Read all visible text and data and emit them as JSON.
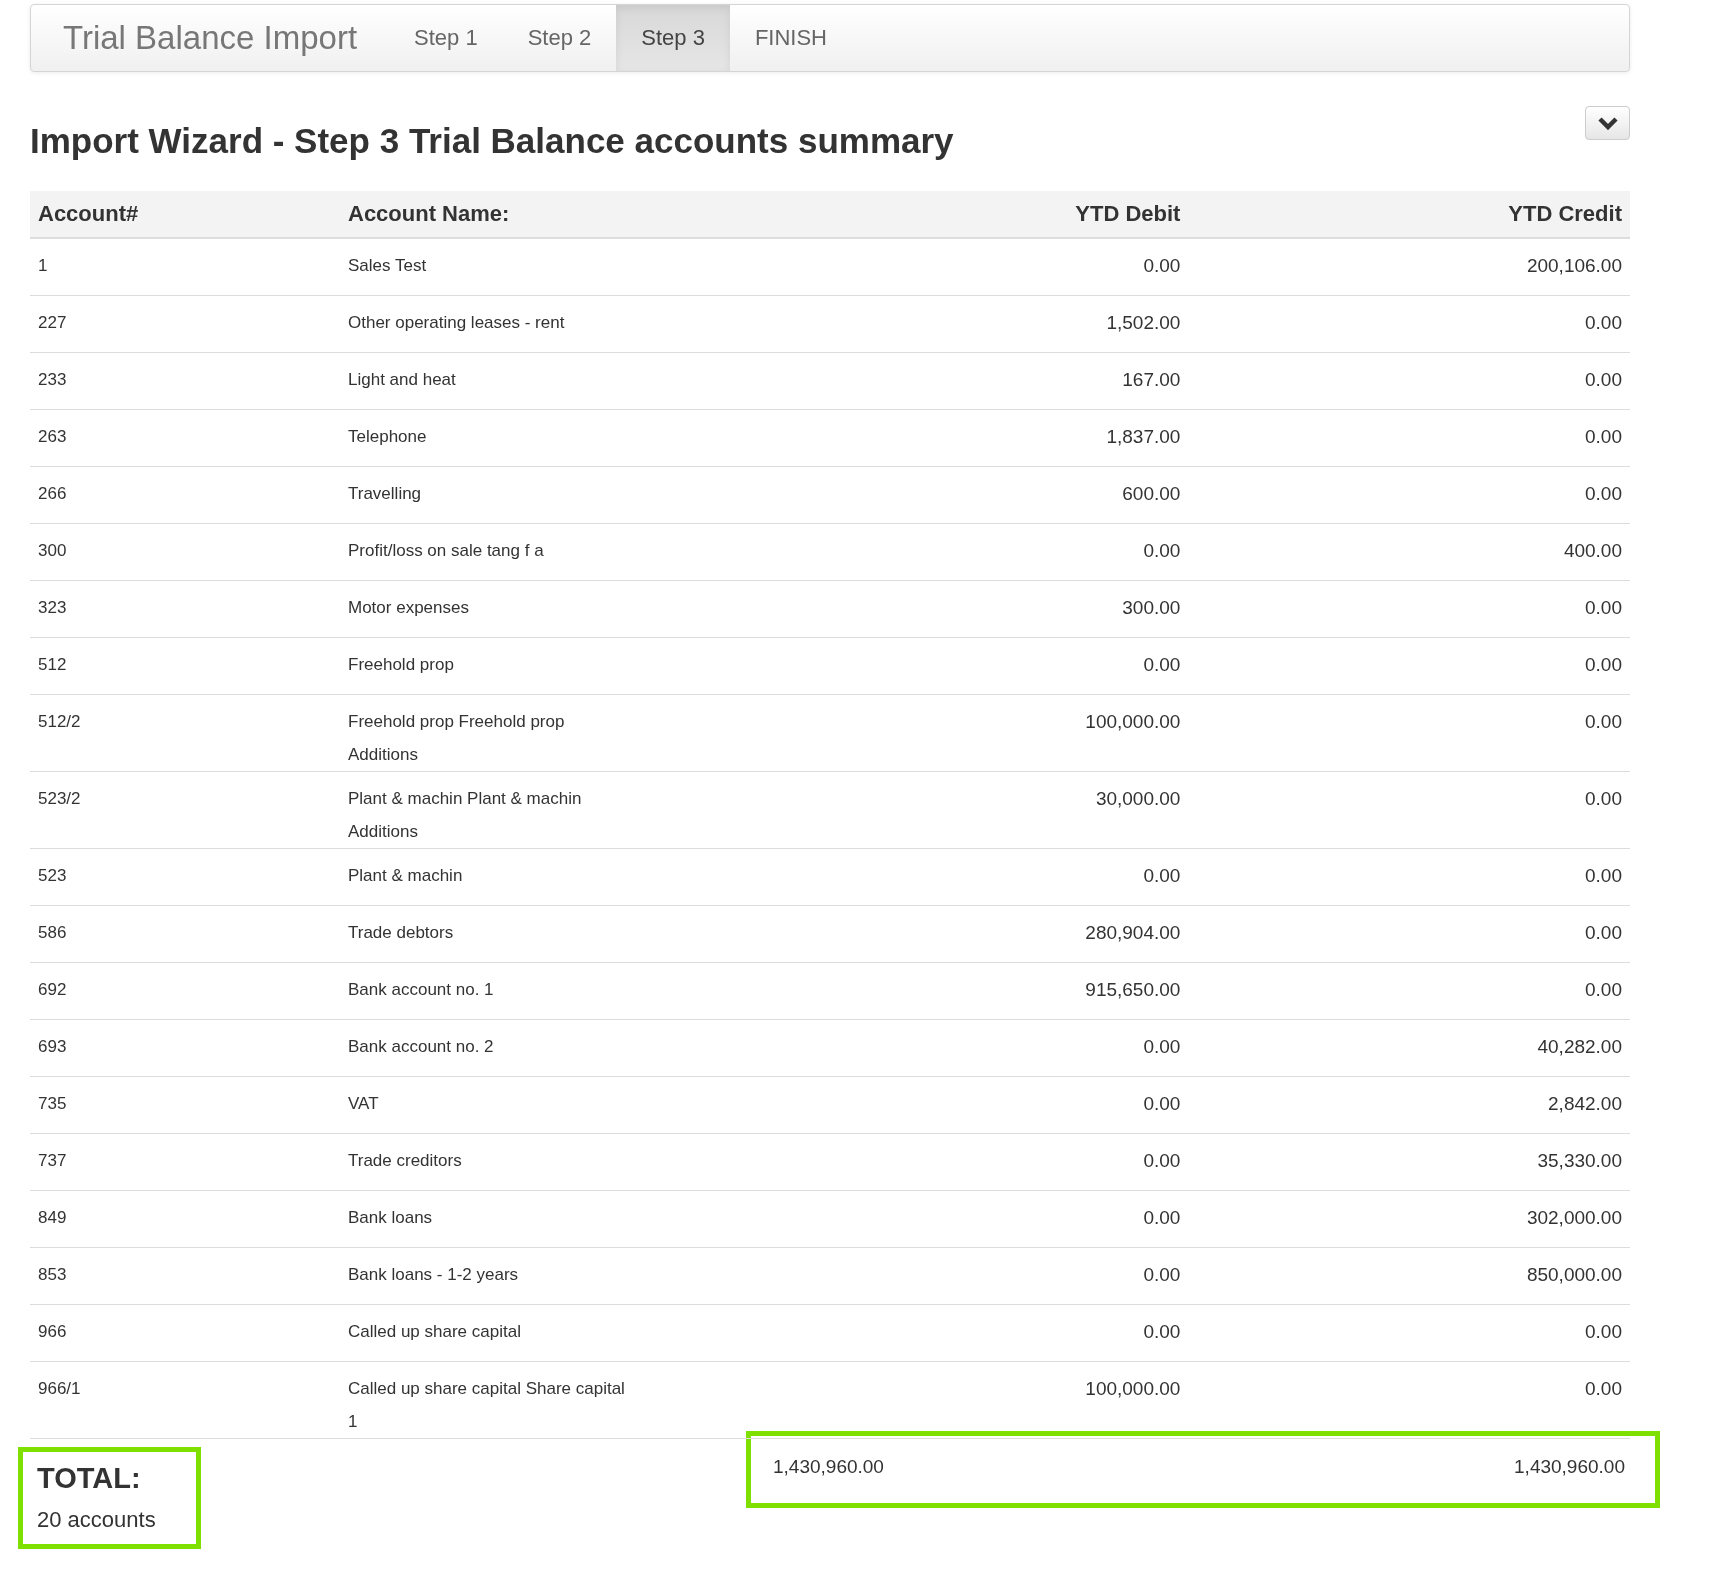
{
  "navbar": {
    "brand": "Trial Balance Import",
    "tabs": [
      {
        "label": "Step 1",
        "selected": false
      },
      {
        "label": "Step 2",
        "selected": false
      },
      {
        "label": "Step 3",
        "selected": true
      },
      {
        "label": "FINISH",
        "selected": false
      }
    ]
  },
  "heading": "Import Wizard - Step 3 Trial Balance accounts summary",
  "table": {
    "columns": [
      "Account#",
      "Account Name:",
      "YTD Debit",
      "YTD Credit"
    ],
    "rows": [
      {
        "account": "1",
        "name_lines": [
          "Sales Test"
        ],
        "debit": "0.00",
        "credit": "200,106.00"
      },
      {
        "account": "227",
        "name_lines": [
          "Other operating leases - rent"
        ],
        "debit": "1,502.00",
        "credit": "0.00"
      },
      {
        "account": "233",
        "name_lines": [
          "Light and heat"
        ],
        "debit": "167.00",
        "credit": "0.00"
      },
      {
        "account": "263",
        "name_lines": [
          "Telephone"
        ],
        "debit": "1,837.00",
        "credit": "0.00"
      },
      {
        "account": "266",
        "name_lines": [
          "Travelling"
        ],
        "debit": "600.00",
        "credit": "0.00"
      },
      {
        "account": "300",
        "name_lines": [
          "Profit/loss on sale tang f a"
        ],
        "debit": "0.00",
        "credit": "400.00"
      },
      {
        "account": "323",
        "name_lines": [
          "Motor expenses"
        ],
        "debit": "300.00",
        "credit": "0.00"
      },
      {
        "account": "512",
        "name_lines": [
          "Freehold prop"
        ],
        "debit": "0.00",
        "credit": "0.00"
      },
      {
        "account": "512/2",
        "name_lines": [
          "Freehold prop Freehold prop",
          "Additions"
        ],
        "debit": "100,000.00",
        "credit": "0.00"
      },
      {
        "account": "523/2",
        "name_lines": [
          "Plant & machin Plant & machin",
          "Additions"
        ],
        "debit": "30,000.00",
        "credit": "0.00"
      },
      {
        "account": "523",
        "name_lines": [
          "Plant & machin"
        ],
        "debit": "0.00",
        "credit": "0.00"
      },
      {
        "account": "586",
        "name_lines": [
          "Trade debtors"
        ],
        "debit": "280,904.00",
        "credit": "0.00"
      },
      {
        "account": "692",
        "name_lines": [
          "Bank account no. 1"
        ],
        "debit": "915,650.00",
        "credit": "0.00"
      },
      {
        "account": "693",
        "name_lines": [
          "Bank account no. 2"
        ],
        "debit": "0.00",
        "credit": "40,282.00"
      },
      {
        "account": "735",
        "name_lines": [
          "VAT"
        ],
        "debit": "0.00",
        "credit": "2,842.00"
      },
      {
        "account": "737",
        "name_lines": [
          "Trade creditors"
        ],
        "debit": "0.00",
        "credit": "35,330.00"
      },
      {
        "account": "849",
        "name_lines": [
          "Bank loans"
        ],
        "debit": "0.00",
        "credit": "302,000.00"
      },
      {
        "account": "853",
        "name_lines": [
          "Bank loans - 1-2 years"
        ],
        "debit": "0.00",
        "credit": "850,000.00"
      },
      {
        "account": "966",
        "name_lines": [
          "Called up share capital"
        ],
        "debit": "0.00",
        "credit": "0.00"
      },
      {
        "account": "966/1",
        "name_lines": [
          "Called up share capital Share capital",
          "1"
        ],
        "debit": "100,000.00",
        "credit": "0.00"
      }
    ],
    "total": {
      "label": "TOTAL:",
      "count": "20 accounts",
      "debit": "1,430,960.00",
      "credit": "1,430,960.00"
    }
  }
}
